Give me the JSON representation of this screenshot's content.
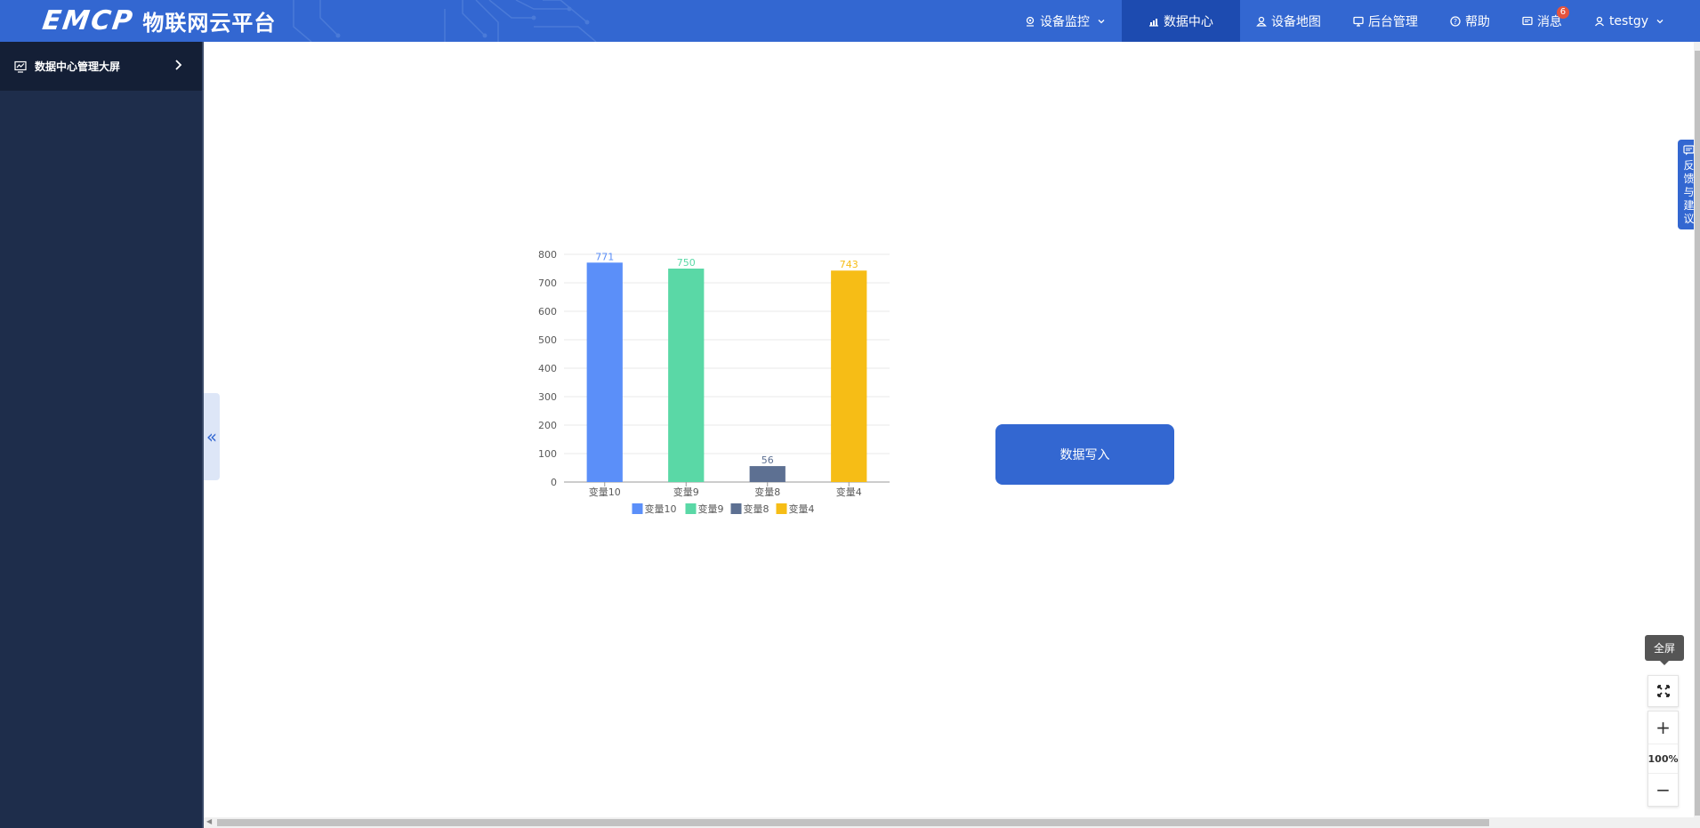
{
  "header": {
    "logo_mark": "EMCP",
    "logo_text": "物联网云平台",
    "nav": [
      {
        "label": "设备监控",
        "icon": "location-pin-icon"
      },
      {
        "label": "数据中心",
        "icon": "bar-chart-icon",
        "active": true
      },
      {
        "label": "设备地图",
        "icon": "user-map-icon"
      },
      {
        "label": "后台管理",
        "icon": "monitor-icon"
      },
      {
        "label": "帮助",
        "icon": "help-circle-icon"
      },
      {
        "label": "消息",
        "icon": "message-icon",
        "badge": "6"
      },
      {
        "label": "testgy",
        "icon": "user-icon"
      }
    ]
  },
  "sidebar": {
    "items": [
      {
        "label": "数据中心管理大屏",
        "icon": "dashboard-chart-icon"
      }
    ]
  },
  "chart_data": {
    "type": "bar",
    "categories": [
      "变量10",
      "变量9",
      "变量8",
      "变量4"
    ],
    "values": [
      771,
      750,
      56,
      743
    ],
    "colors": [
      "#5b8ff9",
      "#5ad8a6",
      "#5d7092",
      "#f6bd16"
    ],
    "legend": [
      "变量10",
      "变量9",
      "变量8",
      "变量4"
    ],
    "legend_position": "bottom",
    "ylim": [
      0,
      800
    ],
    "yticks": [
      0,
      100,
      200,
      300,
      400,
      500,
      600,
      700,
      800
    ],
    "grid": true
  },
  "write_button": {
    "label": "数据写入"
  },
  "feedback": {
    "label": "反馈与建议"
  },
  "zoom": {
    "tooltip": "全屏",
    "level": "100%",
    "plus": "+",
    "minus": "−"
  }
}
